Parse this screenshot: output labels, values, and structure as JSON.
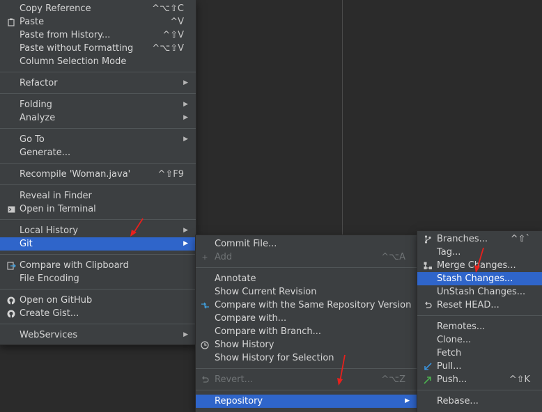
{
  "colors": {
    "menu_bg": "#3c3f41",
    "selection": "#2f65ca",
    "annotation_arrow": "#e8201c"
  },
  "editor_menu": {
    "items": [
      {
        "label": "Copy Reference",
        "shortcut": "^⌥⇧C"
      },
      {
        "label": "Paste",
        "shortcut": "^V",
        "icon": "clipboard-icon"
      },
      {
        "label": "Paste from History...",
        "shortcut": "^⇧V"
      },
      {
        "label": "Paste without Formatting",
        "shortcut": "^⌥⇧V"
      },
      {
        "label": "Column Selection Mode"
      },
      {
        "label": "Refactor",
        "submenu": true
      },
      {
        "label": "Folding",
        "submenu": true
      },
      {
        "label": "Analyze",
        "submenu": true
      },
      {
        "label": "Go To",
        "submenu": true
      },
      {
        "label": "Generate..."
      },
      {
        "label": "Recompile 'Woman.java'",
        "shortcut": "^⇧F9"
      },
      {
        "label": "Reveal in Finder"
      },
      {
        "label": "Open in Terminal",
        "icon": "terminal-icon"
      },
      {
        "label": "Local History",
        "submenu": true
      },
      {
        "label": "Git",
        "submenu": true,
        "selected": true
      },
      {
        "label": "Compare with Clipboard",
        "icon": "compare-clipboard-icon"
      },
      {
        "label": "File Encoding"
      },
      {
        "label": "Open on GitHub",
        "icon": "github-icon"
      },
      {
        "label": "Create Gist...",
        "icon": "github-icon"
      },
      {
        "label": "WebServices",
        "submenu": true
      }
    ]
  },
  "git_menu": {
    "items": [
      {
        "label": "Commit File..."
      },
      {
        "label": "Add",
        "shortcut": "^⌥A",
        "icon": "plus-icon",
        "disabled": true
      },
      {
        "label": "Annotate"
      },
      {
        "label": "Show Current Revision"
      },
      {
        "label": "Compare with the Same Repository Version",
        "icon": "compare-arrows-icon"
      },
      {
        "label": "Compare with..."
      },
      {
        "label": "Compare with Branch..."
      },
      {
        "label": "Show History",
        "icon": "clock-icon"
      },
      {
        "label": "Show History for Selection"
      },
      {
        "label": "Revert...",
        "shortcut": "^⌥Z",
        "icon": "revert-icon",
        "disabled": true
      },
      {
        "label": "Repository",
        "submenu": true,
        "selected": true
      }
    ]
  },
  "repository_menu": {
    "items": [
      {
        "label": "Branches...",
        "shortcut": "^⇧`",
        "icon": "branch-icon"
      },
      {
        "label": "Tag..."
      },
      {
        "label": "Merge Changes...",
        "icon": "merge-icon"
      },
      {
        "label": "Stash Changes...",
        "selected": true
      },
      {
        "label": "UnStash Changes..."
      },
      {
        "label": "Reset HEAD...",
        "icon": "undo-icon"
      },
      {
        "label": "Remotes..."
      },
      {
        "label": "Clone..."
      },
      {
        "label": "Fetch"
      },
      {
        "label": "Pull...",
        "icon": "pull-arrow-icon"
      },
      {
        "label": "Push...",
        "shortcut": "^⇧K",
        "icon": "push-arrow-icon"
      },
      {
        "label": "Rebase..."
      }
    ]
  }
}
